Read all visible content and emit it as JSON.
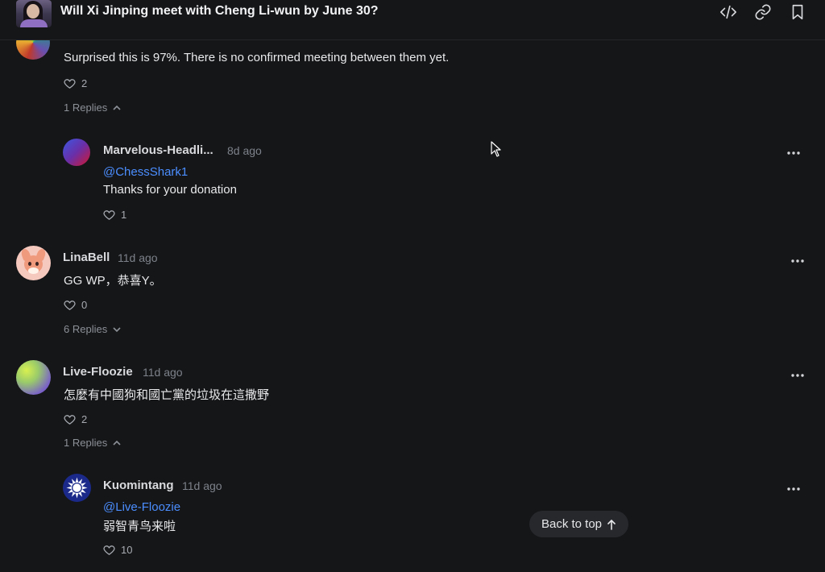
{
  "header": {
    "title": "Will Xi Jinping meet with Cheng Li-wun by June 30?"
  },
  "comments": [
    {
      "text": "Surprised this is 97%. There is no confirmed meeting between them yet.",
      "likes": "2",
      "replies_label": "1 Replies"
    },
    {
      "username": "Marvelous-Headli...",
      "time": "8d ago",
      "mention": "@ChessShark1",
      "text": "Thanks for your donation",
      "likes": "1"
    },
    {
      "username": "LinaBell",
      "time": "11d ago",
      "text": "GG WP，恭喜Y。",
      "likes": "0",
      "replies_label": "6 Replies"
    },
    {
      "username": "Live-Floozie",
      "time": "11d ago",
      "text": "怎麼有中國狗和國亡黨的垃圾在這撒野",
      "likes": "2",
      "replies_label": "1 Replies"
    },
    {
      "username": "Kuomintang",
      "time": "11d ago",
      "mention": "@Live-Floozie",
      "text": "弱智青鸟来啦",
      "likes": "10"
    }
  ],
  "back_to_top": "Back to top",
  "colors": {
    "background": "#151618",
    "mention": "#4b8eff",
    "muted": "#7d828a"
  },
  "icons": [
    "embed-code-icon",
    "link-icon",
    "bookmark-icon",
    "heart-icon",
    "chevron-up-icon",
    "chevron-down-icon",
    "more-dots-icon",
    "arrow-up-icon"
  ]
}
